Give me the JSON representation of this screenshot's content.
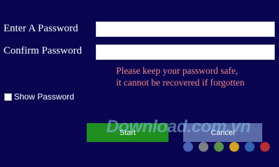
{
  "form": {
    "password_label": "Enter A Password",
    "password_value": "",
    "confirm_label": "Confirm Password",
    "confirm_value": "",
    "warning_line1": "Please keep your password safe,",
    "warning_line2": "it cannot be recovered if forgotten",
    "show_password_label": "Show Password",
    "show_password_checked": false
  },
  "buttons": {
    "start_label": "Start",
    "cancel_label": "Cancel"
  },
  "watermark": {
    "text": "Download.com.vn",
    "dot_colors": [
      "#4a63b8",
      "#7b7f88",
      "#5a8f4a",
      "#d4a227",
      "#2f62b0",
      "#b82e3a"
    ]
  },
  "colors": {
    "background": "#0a0550",
    "warning_text": "#f08a8a",
    "start_button": "#1f8f1f",
    "cancel_button": "#5a6aa8"
  }
}
